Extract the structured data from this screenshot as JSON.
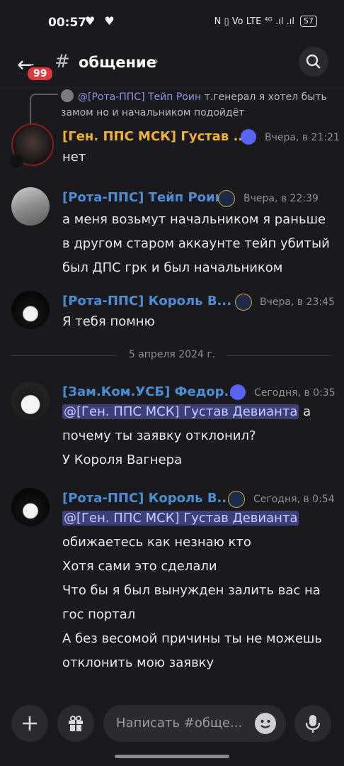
{
  "status_bar": {
    "time": "00:57",
    "hearts": "♥ ♥",
    "signals": "N ▯ Vo LTE ⁴ᴳ .ıl .ıl",
    "battery": "57"
  },
  "header": {
    "unread_badge": "99",
    "channel_name": "общение",
    "chevron": "›"
  },
  "reply_preview": {
    "author": "@[Рота-ППС] Тейп Роин",
    "text": " т.генерал я хотел быть замом но и начальником подойдёт"
  },
  "messages": [
    {
      "author": "[Ген. ППС МСК] Густав ...",
      "author_color": "#f0b232",
      "timestamp": "Вчера, в 21:21",
      "lines": [
        "нет"
      ]
    },
    {
      "author": "[Рота-ППС] Тейп Роин",
      "author_color": "#4a8fd6",
      "timestamp": "Вчера, в 22:39",
      "lines": [
        "а меня возьмут начальником я раньше",
        "в другом старом аккаунте тейп убитый",
        "был ДПС грк и был начальником"
      ]
    },
    {
      "author": "[Рота-ППС]  Король В...",
      "author_color": "#4a8fd6",
      "timestamp": "Вчера, в 23:45",
      "lines": [
        "Я тебя помню"
      ]
    },
    {
      "author": "[Зам.Ком.УСБ] Федор...",
      "author_color": "#4a8fd6",
      "timestamp": "Сегодня, в 0:35",
      "mention": "@[Ген. ППС МСК] Густав Девианта",
      "mention_tail": " а",
      "lines": [
        "почему ты заявку отклонил?",
        "У Короля Вагнера"
      ]
    },
    {
      "author": "[Рота-ППС]  Король В...",
      "author_color": "#4a8fd6",
      "timestamp": "Сегодня, в 0:54",
      "mention": "@[Ген. ППС МСК] Густав Девианта",
      "mention_tail": "",
      "lines": [
        "обижаетесь как незнаю кто",
        "Хотя сами это сделали",
        "Что бы я был вынужден залить вас на",
        "гос портал",
        "А без весомой причины ты не можешь",
        "отклонить мою заявку"
      ]
    }
  ],
  "date_separator": "5 апреля 2024 г.",
  "composer": {
    "placeholder": "Написать #обще...",
    "add_icon": "plus-icon",
    "gift_icon": "gift-icon",
    "mic_icon": "mic-icon"
  }
}
